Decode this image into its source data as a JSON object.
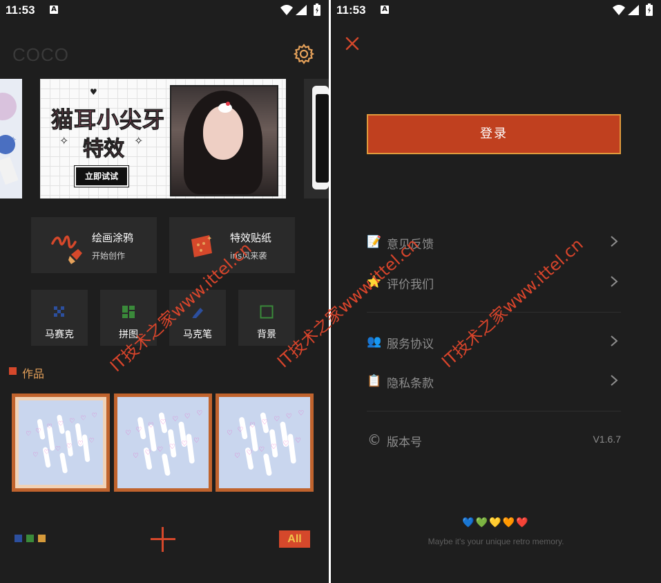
{
  "status_bar": {
    "time": "11:53",
    "notification_icon_letter": "A",
    "icons": [
      "wifi-icon",
      "signal-icon",
      "battery-icon"
    ]
  },
  "home": {
    "app_title": "COCO",
    "banner": {
      "line1": "猫耳小尖牙",
      "line2": "特效",
      "cta": "立即试试"
    },
    "feature_cards": [
      {
        "title": "绘画涂鸦",
        "subtitle": "开始创作",
        "icon": "brush-scribble-icon"
      },
      {
        "title": "特效贴纸",
        "subtitle": "ins风来袭",
        "icon": "sticker-icon"
      }
    ],
    "tools": [
      {
        "label": "马赛克",
        "icon": "mosaic-icon"
      },
      {
        "label": "拼图",
        "icon": "collage-icon"
      },
      {
        "label": "马克笔",
        "icon": "marker-icon"
      },
      {
        "label": "背景",
        "icon": "background-icon"
      }
    ],
    "works_section_title": "作品",
    "works_count": 3,
    "bottom": {
      "all_label": "All",
      "color_swatches": [
        "#2c4f9e",
        "#3a8a3a",
        "#d69a3a"
      ]
    }
  },
  "drawer": {
    "login_label": "登录",
    "menu_group1": [
      {
        "label": "意见反馈",
        "icon": "memo-icon",
        "emoji": "📝"
      },
      {
        "label": "评价我们",
        "icon": "star-icon",
        "emoji": "⭐"
      }
    ],
    "menu_group2": [
      {
        "label": "服务协议",
        "icon": "people-icon",
        "emoji": "👥"
      },
      {
        "label": "隐私条款",
        "icon": "clipboard-icon",
        "emoji": "📋"
      }
    ],
    "version": {
      "label": "版本号",
      "value": "V1.6.7",
      "icon": "copyright-icon",
      "glyph": "©"
    },
    "hearts": "💙💚💛🧡❤️",
    "tagline": "Maybe it's your unique retro memory."
  },
  "watermark": "IT技术之家www.ittel.cn",
  "colors": {
    "background": "#1e1e1e",
    "card": "#2a2a2a",
    "accent": "#d5482b",
    "gold": "#e5a15a",
    "login": "#c0401f"
  }
}
